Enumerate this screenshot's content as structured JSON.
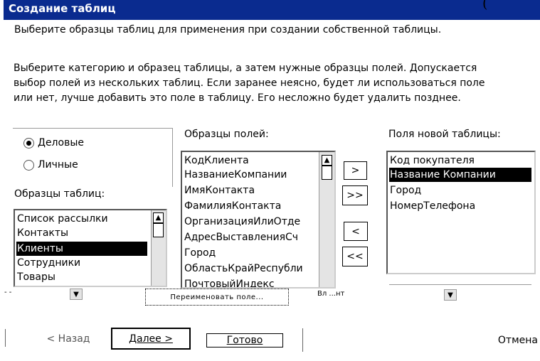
{
  "dialog": {
    "title": "Создание таблиц",
    "corner_glyph": "(",
    "intro": "Выберите образцы таблиц для применения при создании собственной таблицы.",
    "paragraph": [
      "Выберите категорию и образец таблицы, а затем нужные образцы полей. Допускается",
      "выбор полей из нескольких таблиц. Если заранее неясно, будет ли использоваться поле",
      "или нет, лучше добавить это поле в таблицу. Его несложно будет удалить позднее."
    ]
  },
  "category": {
    "options": [
      {
        "label": "Деловые",
        "selected": true
      },
      {
        "label": "Личные",
        "selected": false
      }
    ]
  },
  "sample_tables": {
    "label": "Образцы таблиц:",
    "items": [
      "Список рассылки",
      "Контакты",
      "Клиенты",
      "Сотрудники",
      "Товары"
    ],
    "selected_index": 2
  },
  "sample_fields": {
    "label": "Образцы полей:",
    "items": [
      "КодКлиента",
      "НазваниеКомпании",
      "ИмяКонтакта",
      "ФамилияКонтакта",
      "ОрганизацияИлиОтде",
      "АдресВыставленияСч",
      "Город",
      "ОбластьКрайРеспубли",
      "ПочтовыйИндекс"
    ]
  },
  "new_table_fields": {
    "label": "Поля новой таблицы:",
    "items": [
      "Код покупателя",
      "Название Компании",
      "Город",
      "НомерТелефона"
    ],
    "selected_index": 1
  },
  "move_buttons": {
    "add_one": ">",
    "add_all": ">>",
    "remove_one": "<",
    "remove_all": "<<"
  },
  "garbled_row": {
    "left_combo_text": "- -",
    "rename_button": "Переименовать поле...",
    "right_combo_text": "Вл ...нт"
  },
  "footer": {
    "back": "< Назад",
    "next": "Далее >",
    "finish": "Готово",
    "cancel": "Отмена"
  },
  "colors": {
    "titlebar": "#0a2b8f",
    "selection": "#000000"
  }
}
